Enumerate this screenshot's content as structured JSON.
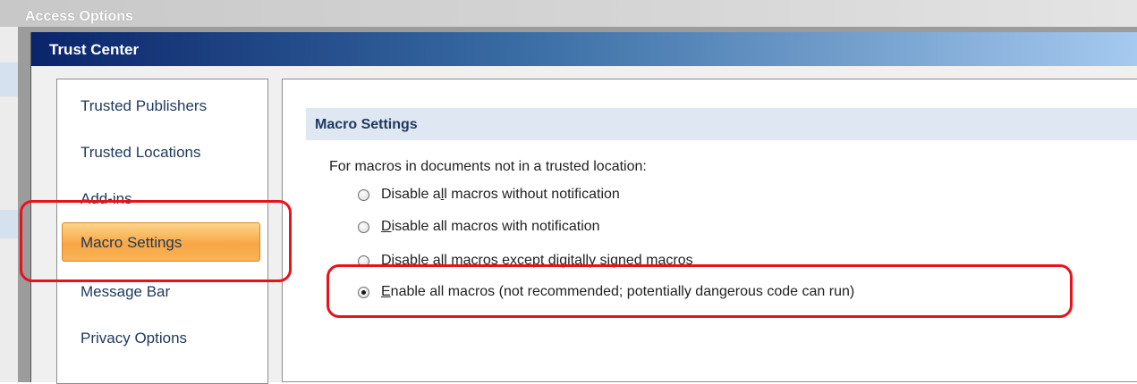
{
  "outer_window": {
    "title": "Access Options"
  },
  "dialog": {
    "title": "Trust Center"
  },
  "nav": {
    "items": [
      {
        "label": "Trusted Publishers",
        "selected": false
      },
      {
        "label": "Trusted Locations",
        "selected": false
      },
      {
        "label": "Add-ins",
        "selected": false
      },
      {
        "label": "Macro Settings",
        "selected": true
      },
      {
        "label": "Message Bar",
        "selected": false
      },
      {
        "label": "Privacy Options",
        "selected": false
      }
    ]
  },
  "content": {
    "section_title": "Macro Settings",
    "intro": "For macros in documents not in a trusted location:",
    "options": [
      {
        "prefix": "Disable a",
        "accel": "l",
        "suffix": "l macros without notification",
        "checked": false
      },
      {
        "prefix": "",
        "accel": "D",
        "suffix": "isable all macros with notification",
        "checked": false
      },
      {
        "prefix": "Disable all macros except digitally signed macros",
        "accel": "",
        "suffix": "",
        "checked": false
      },
      {
        "prefix": "",
        "accel": "E",
        "suffix": "nable all macros (not recommended; potentially dangerous code can run)",
        "checked": true
      }
    ]
  },
  "colors": {
    "annotation": "#e8121b",
    "selected_nav": "#f9a644",
    "title_bar": "#0a246a"
  }
}
